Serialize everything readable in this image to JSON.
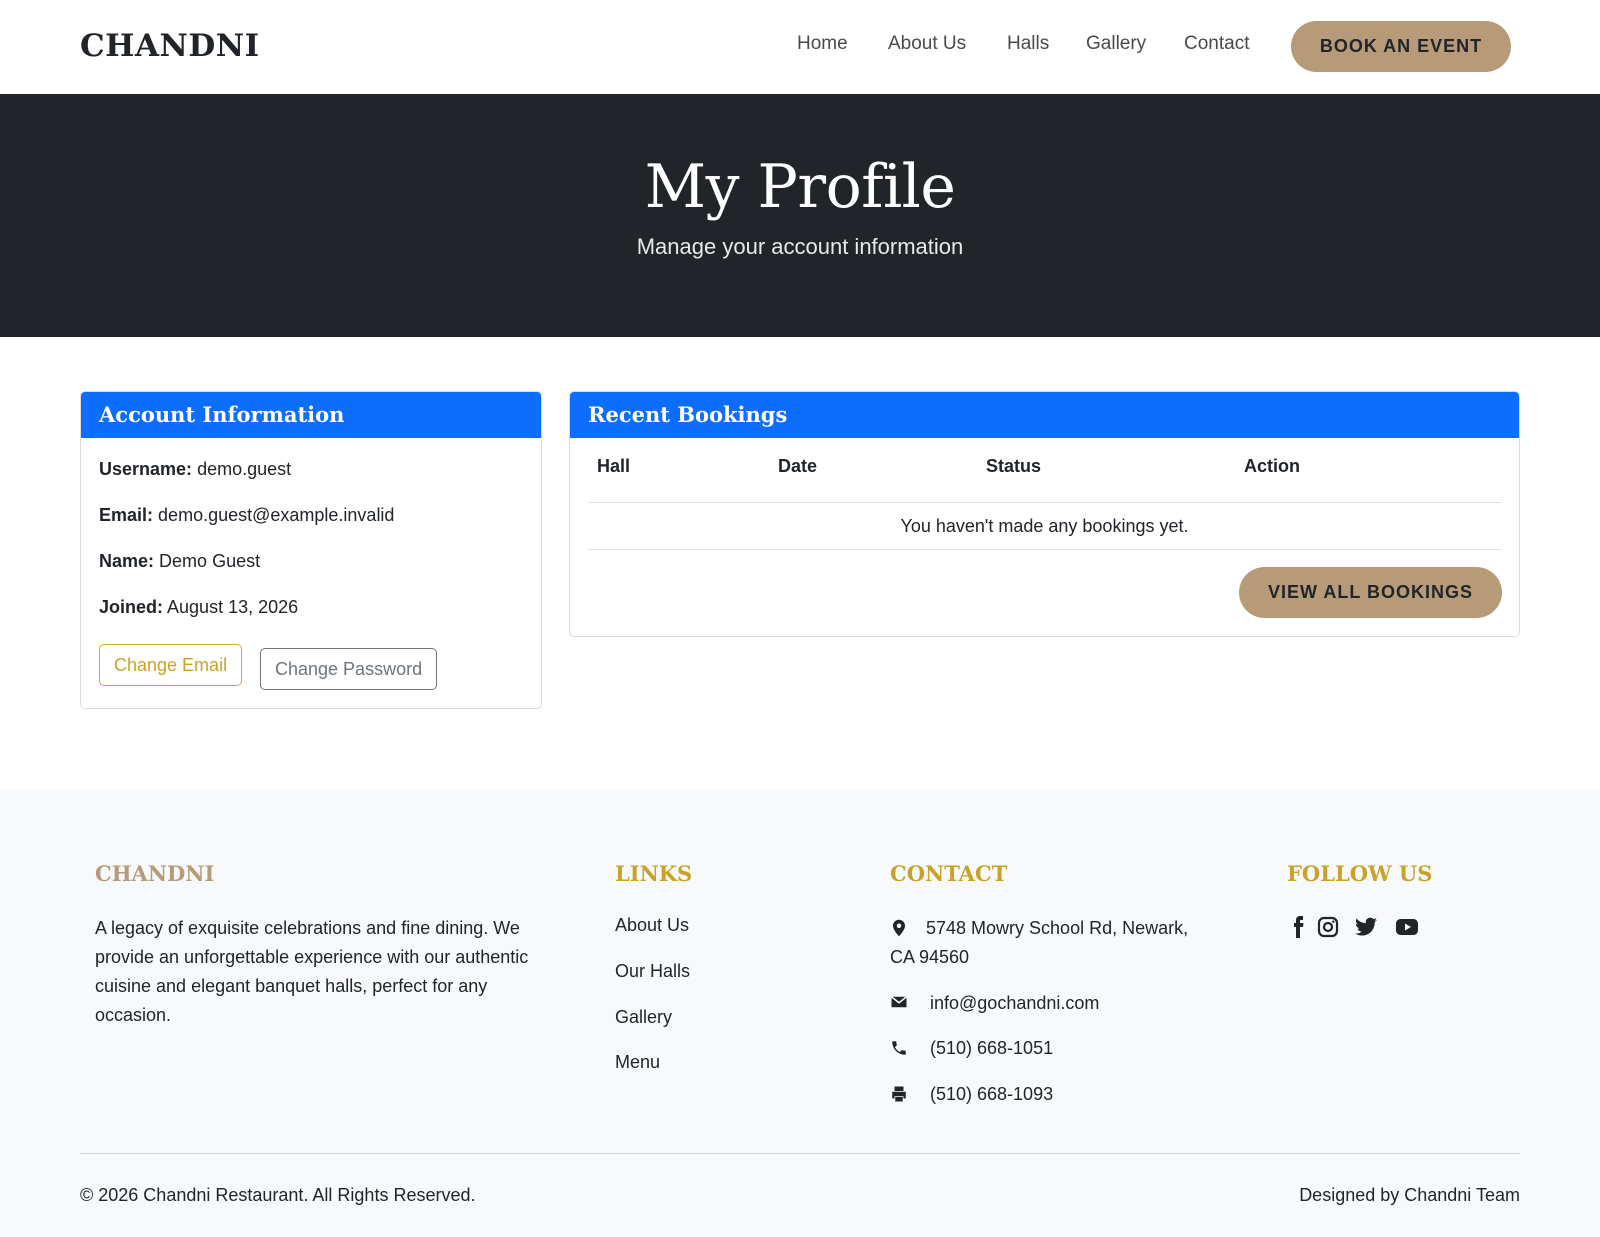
{
  "navbar": {
    "brand": "CHANDNI",
    "links": [
      "Home",
      "About Us",
      "Halls",
      "Gallery",
      "Contact"
    ],
    "cta": "BOOK AN EVENT"
  },
  "hero": {
    "title": "My Profile",
    "subtitle": "Manage your account information"
  },
  "account": {
    "header": "Account Information",
    "rows": [
      {
        "label": "Username:",
        "value": "demo.guest"
      },
      {
        "label": "Email:",
        "value": "demo.guest@example.invalid"
      },
      {
        "label": "Name:",
        "value": "Demo Guest"
      },
      {
        "label": "Joined:",
        "value": "August 13, 2026"
      }
    ],
    "change_email": "Change Email",
    "change_password": "Change Password"
  },
  "bookings": {
    "header": "Recent Bookings",
    "columns": [
      "Hall",
      "Date",
      "Status",
      "Action"
    ],
    "empty_message": "You haven't made any bookings yet.",
    "view_all": "VIEW ALL BOOKINGS"
  },
  "footer": {
    "brand_title": "CHANDNI",
    "about": "A legacy of exquisite celebrations and fine dining. We provide an unforgettable experience with our authentic cuisine and elegant banquet halls, perfect for any occasion.",
    "links_title": "LINKS",
    "links": [
      "About Us",
      "Our Halls",
      "Gallery",
      "Menu"
    ],
    "contact_title": "CONTACT",
    "address_line1": "5748 Mowry School Rd, Newark,",
    "address_line2": "CA 94560",
    "email": "info@gochandni.com",
    "phone": "(510) 668-1051",
    "fax": "(510) 668-1093",
    "follow_title": "FOLLOW US",
    "social_icons": [
      "facebook-icon",
      "instagram-icon",
      "twitter-icon",
      "youtube-icon"
    ],
    "copyright": "© 2026 Chandni Restaurant. All Rights Reserved.",
    "designed_by": "Designed by Chandni Team"
  },
  "colors": {
    "accent_tan": "#b79a78",
    "header_blue": "#0d6efd",
    "hero_dark": "#212529",
    "footer_gold": "#c9a227",
    "footer_tan": "#b79a78"
  }
}
